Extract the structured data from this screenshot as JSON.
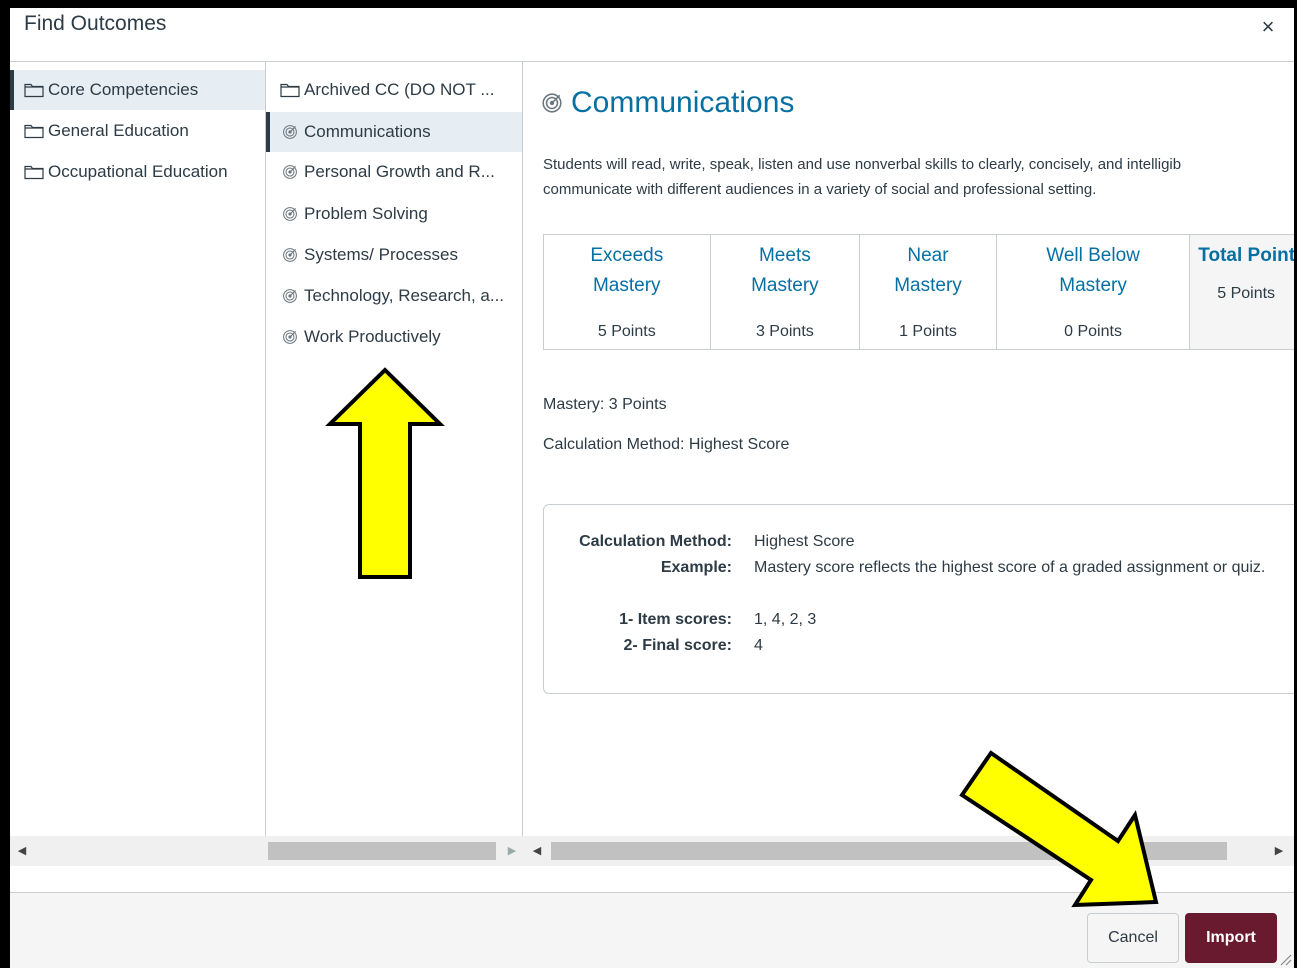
{
  "dialog": {
    "title": "Find Outcomes",
    "close_label": "×"
  },
  "groups": [
    {
      "label": "Core Competencies",
      "selected": true
    },
    {
      "label": "General Education",
      "selected": false
    },
    {
      "label": "Occupational Education",
      "selected": false
    }
  ],
  "outcomes": [
    {
      "label": "Archived CC (DO NOT ...",
      "type": "folder"
    },
    {
      "label": "Communications",
      "type": "outcome",
      "selected": true
    },
    {
      "label": "Personal Growth and R...",
      "type": "outcome"
    },
    {
      "label": "Problem Solving",
      "type": "outcome"
    },
    {
      "label": "Systems/ Processes",
      "type": "outcome"
    },
    {
      "label": "Technology, Research, a...",
      "type": "outcome"
    },
    {
      "label": "Work Productively",
      "type": "outcome"
    }
  ],
  "detail": {
    "title": "Communications",
    "description_line1": "Students will read, write, speak, listen and use nonverbal skills to clearly, concisely, and intelligib",
    "description_line2": "communicate with different audiences in a variety of social and professional setting.",
    "ratings": [
      {
        "line1": "Exceeds",
        "line2": "Mastery",
        "points": "5 Points"
      },
      {
        "line1": "Meets",
        "line2": "Mastery",
        "points": "3 Points"
      },
      {
        "line1": "Near",
        "line2": "Mastery",
        "points": "1 Points"
      },
      {
        "line1": "Well Below",
        "line2": "Mastery",
        "points": "0 Points"
      }
    ],
    "total": {
      "label": "Total Point",
      "points": "5 Points"
    },
    "mastery": "Mastery: 3 Points",
    "calc_method": "Calculation Method: Highest Score",
    "calc_box": {
      "method_label": "Calculation Method:",
      "method_value": "Highest Score",
      "example_label": "Example:",
      "example_value": "Mastery score reflects the highest score of a graded assignment or quiz.",
      "items_label": "1- Item scores:",
      "items_value": "1, 4, 2, 3",
      "final_label": "2- Final score:",
      "final_value": "4"
    }
  },
  "scroll": {
    "left_arrow": "◀",
    "right_arrow": "▶"
  },
  "footer": {
    "cancel_label": "Cancel",
    "import_label": "Import"
  },
  "colors": {
    "accent": "#0770a3",
    "import_button": "#6a1a2e",
    "annotation_arrow": "#ffff00"
  }
}
